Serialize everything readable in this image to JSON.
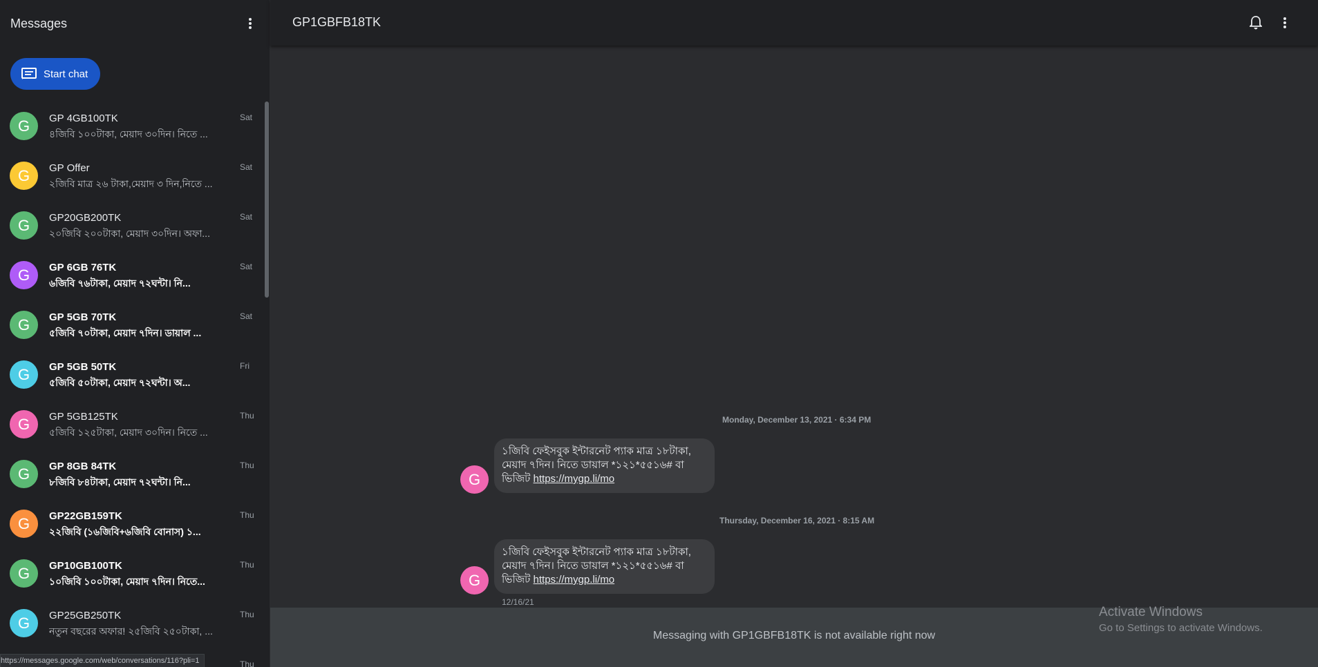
{
  "sidebar": {
    "title": "Messages",
    "start_chat_label": "Start chat",
    "conversations": [
      {
        "name": "GP 4GB100TK",
        "snippet": "৪জিবি ১০০টাকা, মেয়াদ ৩০দিন। নিতে ...",
        "time": "Sat",
        "avatar_letter": "G",
        "avatar_color": "#5bb974",
        "unread": false
      },
      {
        "name": "GP Offer",
        "snippet": "২জিবি মাত্র ২৬ টাকা,মেয়াদ ৩ দিন,নিতে ...",
        "time": "Sat",
        "avatar_letter": "G",
        "avatar_color": "#fcc934",
        "unread": false
      },
      {
        "name": "GP20GB200TK",
        "snippet": "২০জিবি ২০০টাকা, মেয়াদ ৩০দিন। অফা...",
        "time": "Sat",
        "avatar_letter": "G",
        "avatar_color": "#5bb974",
        "unread": false
      },
      {
        "name": "GP 6GB 76TK",
        "snippet": "৬জিবি ৭৬টাকা, মেয়াদ ৭২ঘন্টা। নি...",
        "time": "Sat",
        "avatar_letter": "G",
        "avatar_color": "#af5cf7",
        "unread": true
      },
      {
        "name": "GP 5GB 70TK",
        "snippet": "৫জিবি ৭০টাকা, মেয়াদ ৭দিন। ডায়াল ...",
        "time": "Sat",
        "avatar_letter": "G",
        "avatar_color": "#5bb974",
        "unread": true
      },
      {
        "name": "GP 5GB 50TK",
        "snippet": "৫জিবি ৫০টাকা, মেয়াদ ৭২ঘন্টা। অ...",
        "time": "Fri",
        "avatar_letter": "G",
        "avatar_color": "#4ecde6",
        "unread": true
      },
      {
        "name": "GP 5GB125TK",
        "snippet": "৫জিবি ১২৫টাকা, মেয়াদ ৩০দিন। নিতে ...",
        "time": "Thu",
        "avatar_letter": "G",
        "avatar_color": "#f066b0",
        "unread": false
      },
      {
        "name": "GP 8GB 84TK",
        "snippet": "৮জিবি ৮৪টাকা, মেয়াদ ৭২ঘন্টা। নি...",
        "time": "Thu",
        "avatar_letter": "G",
        "avatar_color": "#5bb974",
        "unread": true
      },
      {
        "name": "GP22GB159TK",
        "snippet": "২২জিবি (১৬জিবি+৬জিবি বোনাস) ১...",
        "time": "Thu",
        "avatar_letter": "G",
        "avatar_color": "#fa903e",
        "unread": true
      },
      {
        "name": "GP10GB100TK",
        "snippet": "১০জিবি ১০০টাকা, মেয়াদ ৭দিন। নিতে...",
        "time": "Thu",
        "avatar_letter": "G",
        "avatar_color": "#5bb974",
        "unread": true
      },
      {
        "name": "GP25GB250TK",
        "snippet": "নতুন বছরের অফার! ২৫জিবি ২৫০টাকা, ...",
        "time": "Thu",
        "avatar_letter": "G",
        "avatar_color": "#4ecde6",
        "unread": false
      },
      {
        "name": "",
        "snippet": "",
        "time": "Thu",
        "avatar_letter": "",
        "avatar_color": "#202124",
        "unread": false
      }
    ]
  },
  "status_url": "https://messages.google.com/web/conversations/116?pli=1",
  "conversation": {
    "title": "GP1GBFB18TK",
    "messages": [
      {
        "date": "Monday, December 13, 2021 · 6:34 PM",
        "avatar_letter": "G",
        "text_line1": "১জিবি ফেইসবুক ইন্টারনেট প্যাক মাত্র ১৮টাকা,",
        "text_line2": "মেয়াদ ৭দিন। নিতে ডায়াল *১২১*৫৫১৬# বা",
        "text_line3": "ভিজিট ",
        "link": "https://mygp.li/mo"
      },
      {
        "date": "Thursday, December 16, 2021 · 8:15 AM",
        "avatar_letter": "G",
        "text_line1": "১জিবি ফেইসবুক ইন্টারনেট প্যাক মাত্র ১৮টাকা,",
        "text_line2": "মেয়াদ ৭দিন। নিতে ডায়াল *১২১*৫৫১৬# বা",
        "text_line3": "ভিজিট ",
        "link": "https://mygp.li/mo",
        "stamp": "12/16/21"
      }
    ],
    "footer_text": "Messaging with GP1GBFB18TK is not available right now"
  },
  "watermark": {
    "title": "Activate Windows",
    "subtitle": "Go to Settings to activate Windows."
  },
  "icons": {
    "sidebar_menu": "more-vert-icon",
    "start_chat": "chat-icon",
    "notifications": "bell-icon",
    "conversation_menu": "more-vert-icon"
  }
}
